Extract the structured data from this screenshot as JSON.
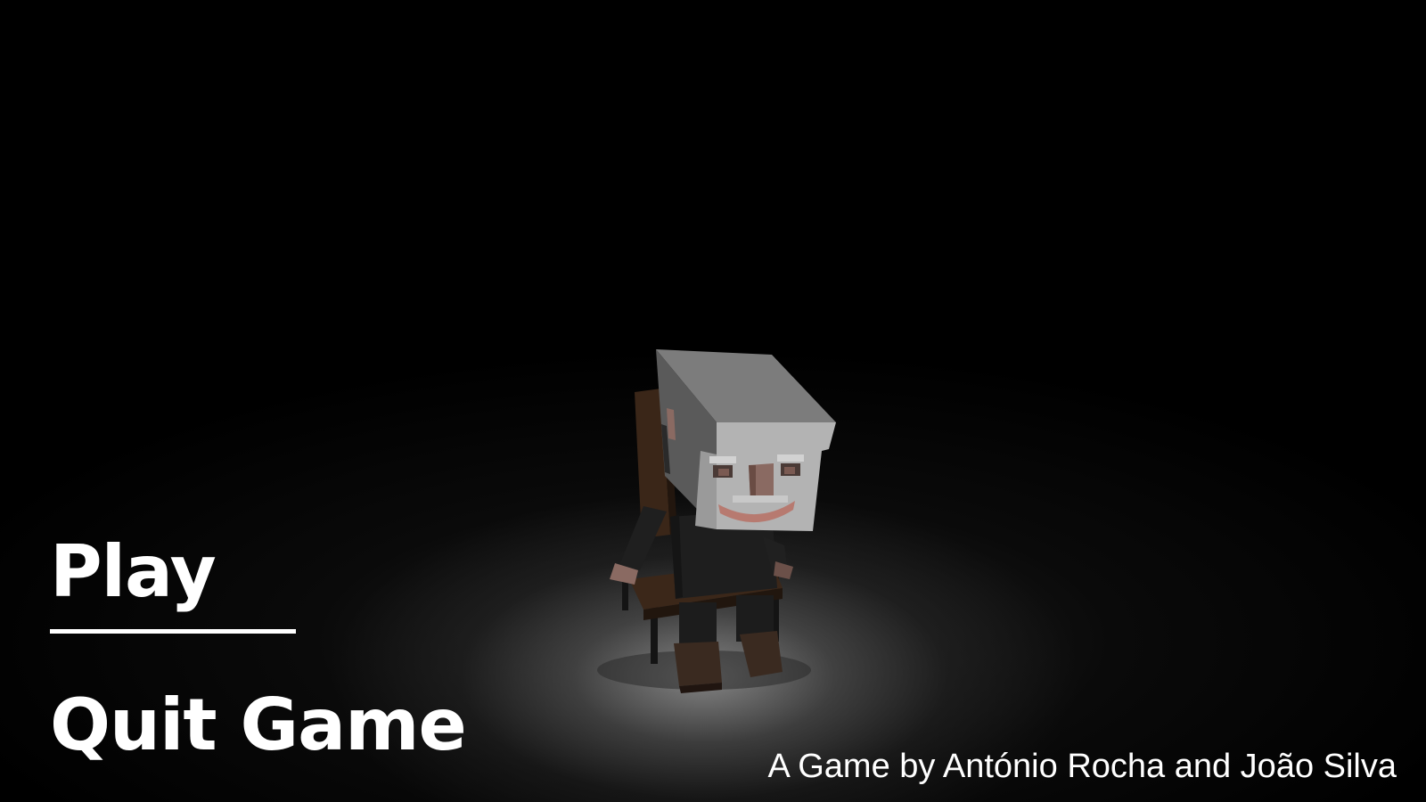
{
  "menu": {
    "play_label": "Play",
    "quit_label": "Quit Game",
    "selected": "Play"
  },
  "credits": {
    "text": "A Game by António Rocha and João Silva"
  },
  "scene": {
    "character": "blocky-old-man-in-chair",
    "spotlight": "on"
  },
  "colors": {
    "background": "#000000",
    "text": "#ffffff",
    "spotlight": "#9a9a9a",
    "head": "#b8b8b8",
    "skin": "#8a6a62",
    "chair": "#3a2a20",
    "body": "#1e1e1e"
  }
}
